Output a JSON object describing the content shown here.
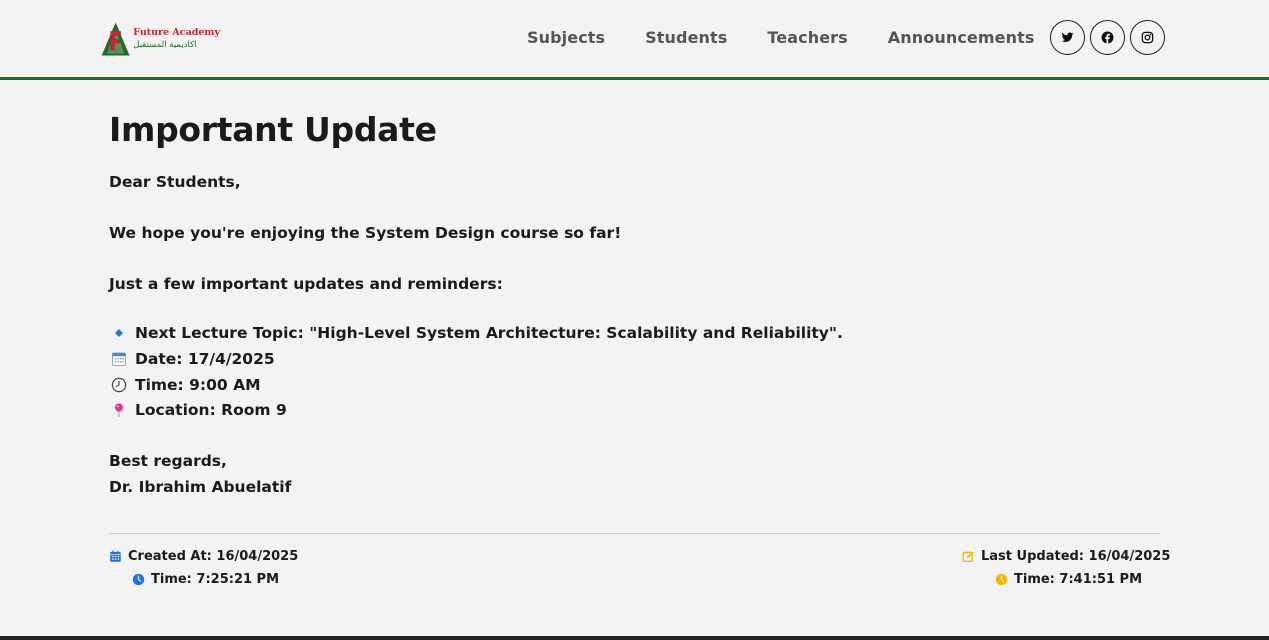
{
  "brand": {
    "name_en": "Future Academy",
    "name_ar": "اكاديمية المستقبل"
  },
  "nav": {
    "links": [
      {
        "label": "Subjects"
      },
      {
        "label": "Students"
      },
      {
        "label": "Teachers"
      },
      {
        "label": "Announcements"
      }
    ],
    "social": [
      {
        "icon": "twitter-icon"
      },
      {
        "icon": "facebook-icon"
      },
      {
        "icon": "instagram-icon"
      }
    ]
  },
  "announcement": {
    "title": "Important Update",
    "greeting": "Dear Students,",
    "intro": "We hope you're enjoying the System Design course so far!",
    "lead": "Just a few important updates and reminders:",
    "items": [
      {
        "icon": "diamond-icon",
        "text": "Next Lecture Topic: \"High-Level System Architecture: Scalability and Reliability\"."
      },
      {
        "icon": "calendar-icon",
        "text": "Date: 17/4/2025"
      },
      {
        "icon": "clock-icon",
        "text": "Time: 9:00 AM"
      },
      {
        "icon": "pushpin-icon",
        "text": "Location: Room 9"
      }
    ],
    "closing": "Best regards,",
    "signature": "Dr. Ibrahim Abuelatif"
  },
  "meta": {
    "created_date": "Created At: 16/04/2025",
    "created_time": "Time: 7:25:21 PM",
    "updated_date": "Last Updated: 16/04/2025",
    "updated_time": "Time: 7:41:51 PM"
  },
  "colors": {
    "accent_green": "#1e6b26",
    "created_icon": "#1a73e8",
    "updated_icon": "#f2b700"
  }
}
